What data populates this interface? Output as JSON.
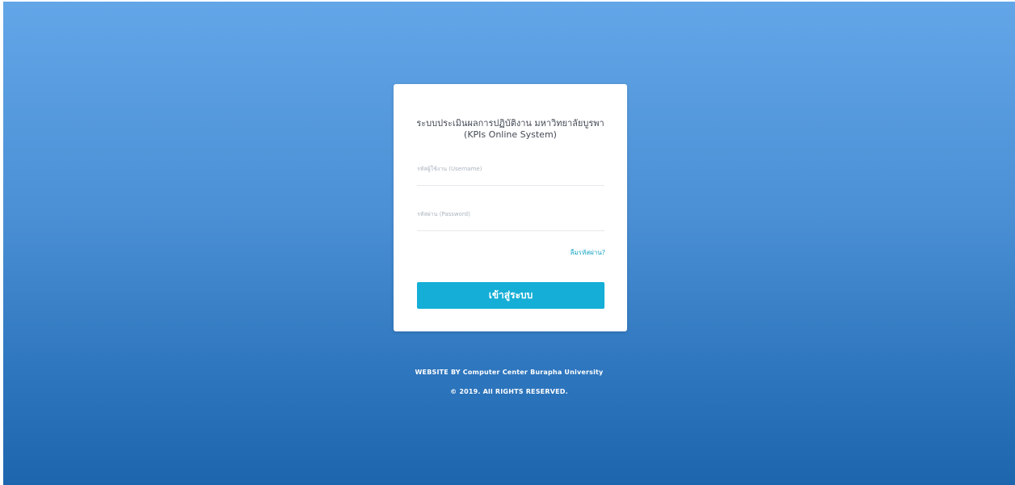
{
  "login": {
    "title_line1": "ระบบประเมินผลการปฏิบัติงาน มหาวิทยาลัยบูรพา",
    "title_line2": "(KPIs Online System)",
    "username_placeholder": "รหัสผู้ใช้งาน (Username)",
    "username_value": "",
    "password_placeholder": "รหัสผ่าน (Password)",
    "password_value": "",
    "forgot_label": "ลืมรหัสผ่าน?",
    "submit_label": "เข้าสู่ระบบ"
  },
  "footer": {
    "credit": "WEBSITE BY Computer Center Burapha University",
    "copyright": "© 2019. All RIGHTS RESERVED."
  },
  "colors": {
    "gradient_top": "#63a6e8",
    "gradient_bottom": "#1d66ad",
    "button": "#14aed6",
    "link": "#1aa6c4"
  }
}
